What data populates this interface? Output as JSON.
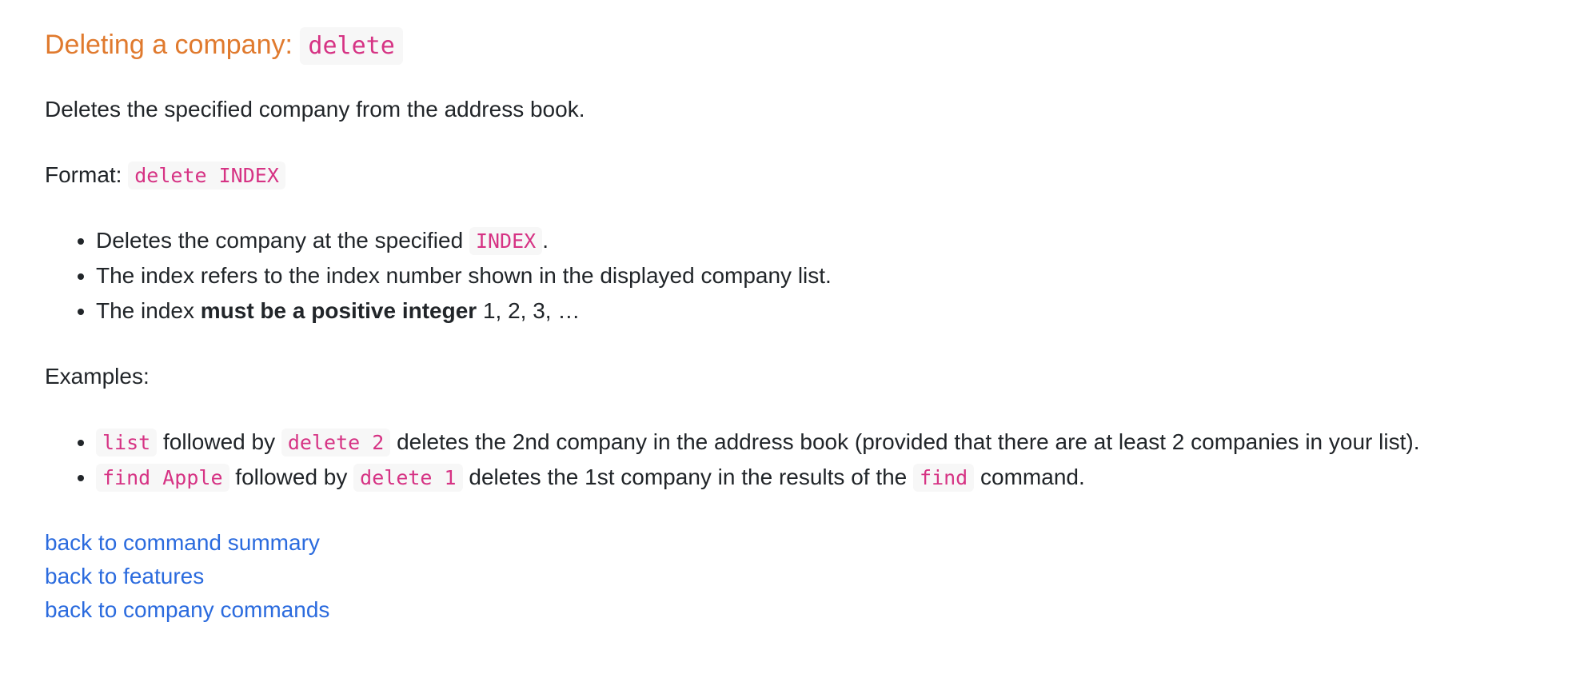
{
  "heading": {
    "text": "Deleting a company:",
    "code": "delete"
  },
  "description": "Deletes the specified company from the address book.",
  "format": {
    "label": "Format:",
    "code": "delete INDEX"
  },
  "bullets": {
    "b1": {
      "pre": "Deletes the company at the specified",
      "code": "INDEX",
      "post": "."
    },
    "b2": {
      "text": "The index refers to the index number shown in the displayed company list."
    },
    "b3": {
      "pre": "The index",
      "bold": "must be a positive integer",
      "post": "1, 2, 3, …"
    }
  },
  "examples": {
    "label": "Examples:",
    "e1": {
      "code1": "list",
      "mid": "followed by",
      "code2": "delete 2",
      "post": "deletes the 2nd company in the address book (provided that there are at least 2 companies in your list)."
    },
    "e2": {
      "code1": "find Apple",
      "mid": "followed by",
      "code2": "delete 1",
      "post1": "deletes the 1st company in the results of the",
      "code3": "find",
      "post2": "command."
    }
  },
  "links": [
    "back to command summary",
    "back to features",
    "back to company commands"
  ],
  "colors": {
    "heading": "#e07a2e",
    "code_text": "#d63384",
    "code_bg": "#f7f7f7",
    "link": "#2b6bde",
    "body_text": "#212529"
  }
}
